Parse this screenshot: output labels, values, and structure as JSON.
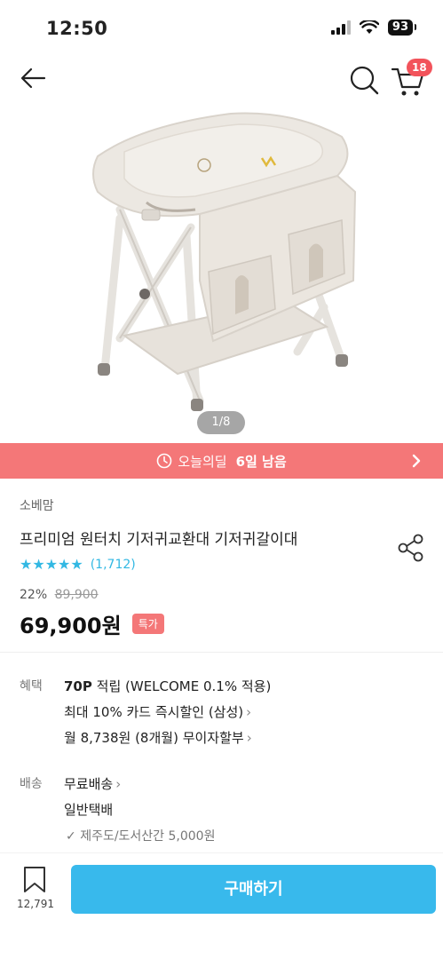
{
  "status": {
    "time": "12:50",
    "battery": "93"
  },
  "nav": {
    "cart_count": "18"
  },
  "gallery": {
    "counter": "1/8"
  },
  "deal": {
    "label": "오늘의딜",
    "remaining": "6일 남음"
  },
  "product": {
    "brand": "소베맘",
    "title": "프리미엄 원터치 기저귀교환대 기저귀갈이대",
    "stars": "★★★★★",
    "review_count": "(1,712)",
    "discount": "22%",
    "original_price": "89,900",
    "price": "69,900원",
    "special_badge": "특가"
  },
  "benefits": {
    "label": "혜택",
    "points_bold": "70P",
    "points_text": " 적립 (WELCOME 0.1% 적용)",
    "card_discount": "최대 10% 카드 즉시할인 (삼성)",
    "installment": "월 8,738원 (8개월) 무이자할부"
  },
  "shipping": {
    "label": "배송",
    "fee": "무료배송",
    "method": "일반택배",
    "extra": "제주도/도서산간 5,000원"
  },
  "bottom": {
    "bookmark_count": "12,791",
    "buy_label": "구매하기"
  },
  "colors": {
    "accent": "#38b9ec",
    "deal": "#f47778",
    "badge": "#f2535b",
    "star": "#32b8e3"
  }
}
